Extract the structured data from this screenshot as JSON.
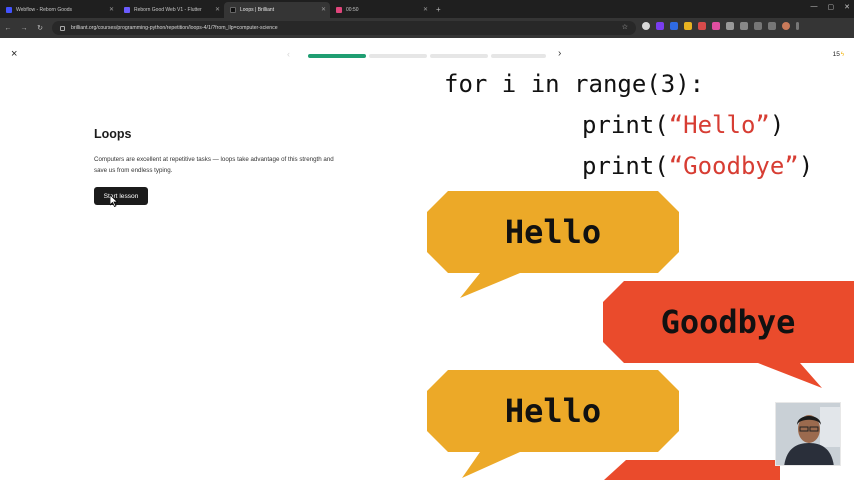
{
  "browser": {
    "tabs": [
      {
        "title": "Webflow - Reborn Goods",
        "favicon_color": "#4353ff",
        "active": false
      },
      {
        "title": "Reborn Good Web V1 - Flutter",
        "favicon_color": "#6b5cff",
        "active": false
      },
      {
        "title": "Loops | Brilliant",
        "favicon_color": "#000000",
        "active": true
      },
      {
        "title": "00:50",
        "favicon_color": "#e0457b",
        "active": false
      }
    ],
    "new_tab_symbol": "+",
    "url": "brilliant.org/courses/programming-python/repetition/loops-4/1/?from_llp=computer-science"
  },
  "lesson": {
    "close_symbol": "×",
    "prev_symbol": "‹",
    "next_symbol": "›",
    "progress_segments": [
      {
        "fill": 1.0
      },
      {
        "fill": 0.0
      },
      {
        "fill": 0.0
      },
      {
        "fill": 0.0
      }
    ],
    "streak_count": "15",
    "streak_symbol": "ϟ",
    "title": "Loops",
    "description": "Computers are excellent at repetitive tasks — loops take advantage of this strength and save us from endless typing.",
    "start_label": "Start lesson"
  },
  "illustration": {
    "code_line_1": "for i in range(3):",
    "code_line_2_fn": "print(",
    "code_line_2_str": "“Hello”",
    "code_line_2_end": ")",
    "code_line_3_fn": "print(",
    "code_line_3_str": "“Goodbye”",
    "code_line_3_end": ")",
    "bubble_hello_1": "Hello",
    "bubble_goodbye": "Goodbye",
    "bubble_hello_2": "Hello",
    "hello_color": "#eca928",
    "goodbye_color": "#ea4b2c"
  },
  "colors": {
    "accent_green": "#1f9e72",
    "bolt": "#f1b000"
  }
}
